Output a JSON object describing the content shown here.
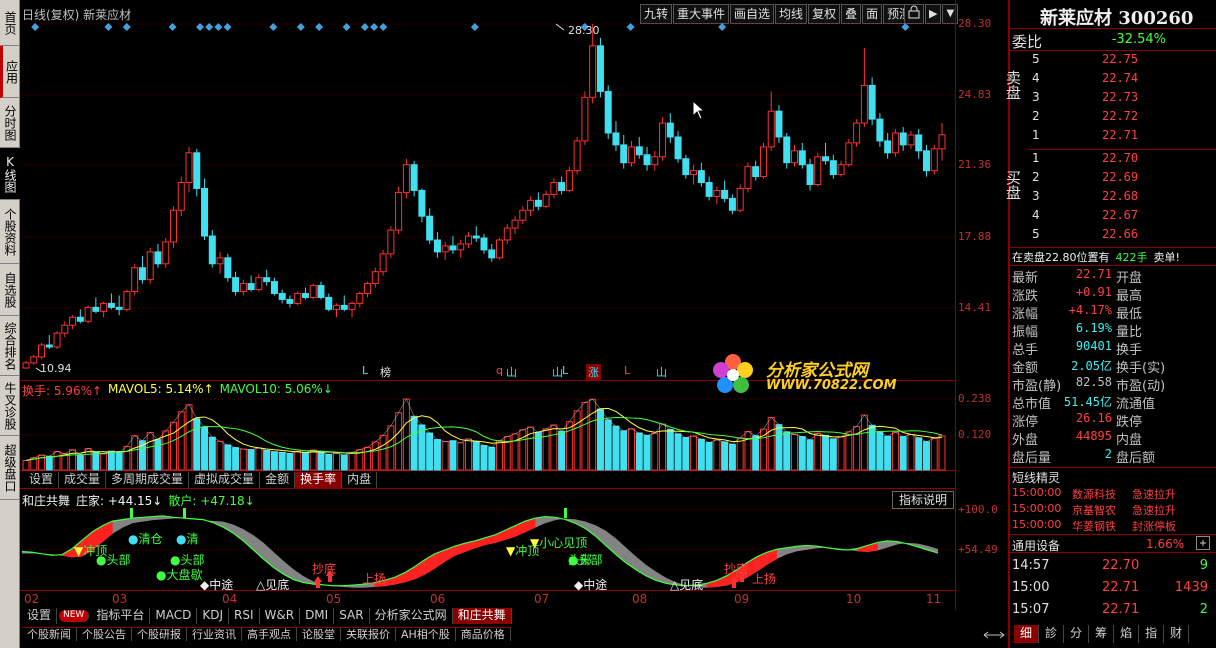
{
  "left_nav": [
    {
      "label": "首页",
      "active": false
    },
    {
      "label": "应用",
      "active": false,
      "accent": true
    },
    {
      "label": "分时图",
      "active": false
    },
    {
      "label": "K线图",
      "active": true,
      "accent": true
    },
    {
      "label": "个股资料",
      "active": false
    },
    {
      "label": "自选股",
      "active": false
    },
    {
      "label": "综合排名",
      "active": false
    },
    {
      "label": "牛叉诊股",
      "active": false
    },
    {
      "label": "超级盘口",
      "active": false
    }
  ],
  "chart_header": {
    "title": "日线(复权)  新莱应材"
  },
  "toolbar": [
    "九转",
    "重大事件",
    "画自选",
    "均线",
    "复权",
    "叠",
    "面",
    "预测"
  ],
  "price_axis": [
    "28.30",
    "24.83",
    "21.36",
    "17.88",
    "14.41"
  ],
  "annotations": {
    "high": "28.30",
    "low": "10.94"
  },
  "event_markers": [
    "L",
    "榜",
    "q",
    "山",
    "山",
    "L",
    "涨",
    "L",
    "山"
  ],
  "volume_header": {
    "label": "换手: 5.96%↑",
    "mavol5": "MAVOL5: 5.14%↑",
    "mavol10": "MAVOL10: 5.06%↓"
  },
  "volume_axis": [
    "0.238",
    "0.120"
  ],
  "volume_tabs": [
    "设置",
    "成交量",
    "多周期成交量",
    "虚拟成交量",
    "金额",
    "换手率",
    "内盘"
  ],
  "volume_tab_active": 5,
  "indicator_header": {
    "name": "和庄共舞",
    "zhuangjia": "庄家: +44.15↓",
    "sanhu": "散户: +47.18↓"
  },
  "indicator_btn": "指标说明",
  "indicator_axis": [
    "+100.0",
    "+54.49"
  ],
  "indicator_labels": [
    {
      "t": "冲顶",
      "c": "#40ff40"
    },
    {
      "t": "头部",
      "c": "#40ff40"
    },
    {
      "t": "清仓",
      "c": "#40ff40"
    },
    {
      "t": "清",
      "c": "#40ff40"
    },
    {
      "t": "头部",
      "c": "#40ff40"
    },
    {
      "t": "头部",
      "c": "#40ff40"
    },
    {
      "t": "大盘歇",
      "c": "#40ff40"
    },
    {
      "t": "中途",
      "c": "#f0f0f0"
    },
    {
      "t": "见底",
      "c": "#f0f0f0"
    },
    {
      "t": "抄底",
      "c": "#ff4040"
    },
    {
      "t": "上扬",
      "c": "#ff4040"
    },
    {
      "t": "冲顶",
      "c": "#40ff40"
    },
    {
      "t": "小心见顶",
      "c": "#40ff40"
    },
    {
      "t": "头部",
      "c": "#40ff40"
    },
    {
      "t": "中途",
      "c": "#f0f0f0"
    },
    {
      "t": "见底",
      "c": "#f0f0f0"
    },
    {
      "t": "抄底",
      "c": "#ff4040"
    },
    {
      "t": "上扬",
      "c": "#ff4040"
    }
  ],
  "x_axis": [
    "02",
    "03",
    "04",
    "05",
    "06",
    "07",
    "08",
    "09",
    "10",
    "11"
  ],
  "indicator_tabs": [
    "设置",
    "NEW",
    "指标平台",
    "MACD",
    "KDJ",
    "RSI",
    "W&R",
    "DMI",
    "SAR",
    "分析家公式网",
    "和庄共舞"
  ],
  "indicator_tab_active": 10,
  "bottom_tabs": [
    "个股新闻",
    "个股公告",
    "个股研报",
    "行业资讯",
    "高手观点",
    "论股堂",
    "关联报价",
    "AH相个股",
    "商品价格"
  ],
  "watermark": {
    "line1": "分析家公式网",
    "line2": "WWW.70822.COM"
  },
  "quote": {
    "stock_name": "新莱应材 300260",
    "weibi_label": "委比",
    "weibi": "-32.54%",
    "sell_label": "卖盘",
    "buy_label": "买盘",
    "sells": [
      {
        "lv": "5",
        "p": "22.75"
      },
      {
        "lv": "4",
        "p": "22.74"
      },
      {
        "lv": "3",
        "p": "22.73"
      },
      {
        "lv": "2",
        "p": "22.72"
      },
      {
        "lv": "1",
        "p": "22.71"
      }
    ],
    "buys": [
      {
        "lv": "1",
        "p": "22.70"
      },
      {
        "lv": "2",
        "p": "22.69"
      },
      {
        "lv": "3",
        "p": "22.68"
      },
      {
        "lv": "4",
        "p": "22.67"
      },
      {
        "lv": "5",
        "p": "22.66"
      }
    ],
    "notice_a": "在卖盘22.80位置有",
    "notice_b": "422手",
    "notice_c": "卖单!",
    "rows": [
      {
        "k": "最新",
        "v": "22.71",
        "c": "#ff4040",
        "k2": "开盘"
      },
      {
        "k": "涨跌",
        "v": "+0.91",
        "c": "#ff4040",
        "k2": "最高"
      },
      {
        "k": "涨幅",
        "v": "+4.17%",
        "c": "#ff4040",
        "k2": "最低"
      },
      {
        "k": "振幅",
        "v": "6.19%",
        "c": "#40f0f0",
        "k2": "量比"
      },
      {
        "k": "总手",
        "v": "90401",
        "c": "#40f0f0",
        "k2": "换手"
      },
      {
        "k": "金额",
        "v": "2.05亿",
        "c": "#40f0f0",
        "k2": "换手(实)"
      },
      {
        "k": "市盈(静)",
        "v": "82.58",
        "c": "#c0c0c0",
        "k2": "市盈(动)"
      },
      {
        "k": "总市值",
        "v": "51.45亿",
        "c": "#40f0f0",
        "k2": "流通值"
      },
      {
        "k": "涨停",
        "v": "26.16",
        "c": "#ff4040",
        "k2": "跌停"
      },
      {
        "k": "外盘",
        "v": "44895",
        "c": "#ff4040",
        "k2": "内盘"
      },
      {
        "k": "盘后量",
        "v": "2",
        "c": "#40f0f0",
        "k2": "盘后额"
      }
    ],
    "short_title": "短线精灵",
    "news": [
      {
        "t": "15:00:00",
        "n": "数源科技",
        "e": "急速拉升"
      },
      {
        "t": "15:00:00",
        "n": "京基智农",
        "e": "急速拉升"
      },
      {
        "t": "15:00:00",
        "n": "华菱钢铁",
        "e": "封涨停板"
      }
    ],
    "sector": "通用设备",
    "sector_pct": "1.66%",
    "ticks": [
      {
        "t": "14:57",
        "p": "22.70",
        "v": "9",
        "c": "#40ff40"
      },
      {
        "t": "15:00",
        "p": "22.71",
        "v": "1439",
        "c": "#ff4040"
      },
      {
        "t": "15:07",
        "p": "22.71",
        "v": "2",
        "c": "#40ff40"
      }
    ],
    "tabs": [
      "细",
      "診",
      "分",
      "筹",
      "焰",
      "指",
      "财"
    ]
  },
  "candles": [
    [
      10.94,
      11.3,
      10.9,
      11.2
    ],
    [
      11.2,
      11.6,
      11.1,
      11.5
    ],
    [
      11.5,
      12.2,
      11.4,
      12.1
    ],
    [
      12.1,
      12.6,
      11.9,
      12.0
    ],
    [
      12.0,
      12.8,
      11.9,
      12.7
    ],
    [
      12.7,
      13.3,
      12.5,
      13.1
    ],
    [
      13.1,
      13.6,
      12.9,
      13.5
    ],
    [
      13.5,
      13.9,
      13.2,
      13.3
    ],
    [
      13.3,
      14.1,
      13.2,
      14.0
    ],
    [
      14.0,
      14.5,
      13.7,
      13.8
    ],
    [
      13.8,
      14.3,
      13.5,
      14.2
    ],
    [
      14.2,
      14.7,
      13.9,
      14.0
    ],
    [
      14.0,
      14.6,
      13.6,
      13.9
    ],
    [
      13.9,
      14.9,
      13.8,
      14.8
    ],
    [
      14.8,
      16.2,
      14.6,
      16.0
    ],
    [
      16.0,
      16.6,
      15.2,
      15.4
    ],
    [
      15.4,
      17.0,
      15.2,
      16.8
    ],
    [
      16.8,
      17.2,
      16.0,
      16.2
    ],
    [
      16.2,
      17.5,
      16.0,
      17.3
    ],
    [
      17.3,
      19.1,
      17.0,
      18.9
    ],
    [
      18.9,
      20.6,
      18.6,
      20.3
    ],
    [
      20.3,
      22.1,
      19.8,
      21.8
    ],
    [
      21.8,
      22.0,
      19.6,
      20.0
    ],
    [
      20.0,
      20.5,
      17.4,
      17.6
    ],
    [
      17.6,
      17.9,
      16.0,
      16.2
    ],
    [
      16.2,
      16.8,
      15.7,
      16.5
    ],
    [
      16.5,
      16.7,
      15.3,
      15.5
    ],
    [
      15.5,
      15.8,
      14.6,
      14.8
    ],
    [
      14.8,
      15.4,
      14.6,
      15.2
    ],
    [
      15.2,
      15.6,
      14.8,
      14.9
    ],
    [
      14.9,
      15.7,
      14.8,
      15.5
    ],
    [
      15.5,
      15.9,
      15.1,
      15.3
    ],
    [
      15.3,
      15.5,
      14.6,
      14.7
    ],
    [
      14.7,
      14.9,
      14.2,
      14.4
    ],
    [
      14.4,
      14.6,
      14.0,
      14.2
    ],
    [
      14.2,
      14.8,
      14.1,
      14.7
    ],
    [
      14.7,
      15.0,
      14.4,
      14.5
    ],
    [
      14.5,
      15.2,
      14.4,
      15.1
    ],
    [
      15.1,
      15.3,
      14.4,
      14.5
    ],
    [
      14.5,
      14.7,
      13.8,
      13.9
    ],
    [
      13.9,
      14.2,
      13.5,
      14.1
    ],
    [
      14.1,
      14.6,
      13.8,
      13.9
    ],
    [
      13.9,
      14.3,
      13.5,
      14.2
    ],
    [
      14.2,
      14.8,
      14.0,
      14.7
    ],
    [
      14.7,
      15.3,
      14.5,
      15.2
    ],
    [
      15.2,
      16.0,
      15.0,
      15.8
    ],
    [
      15.8,
      16.9,
      15.6,
      16.7
    ],
    [
      16.7,
      18.1,
      16.5,
      17.9
    ],
    [
      17.9,
      20.1,
      17.7,
      19.8
    ],
    [
      19.8,
      21.5,
      19.5,
      21.2
    ],
    [
      21.2,
      21.4,
      19.6,
      19.9
    ],
    [
      19.9,
      20.0,
      18.3,
      18.6
    ],
    [
      18.6,
      19.0,
      17.2,
      17.4
    ],
    [
      17.4,
      17.8,
      16.5,
      16.8
    ],
    [
      16.8,
      17.3,
      16.4,
      17.1
    ],
    [
      17.1,
      17.6,
      16.7,
      16.9
    ],
    [
      16.9,
      17.4,
      16.5,
      17.2
    ],
    [
      17.2,
      17.8,
      17.0,
      17.6
    ],
    [
      17.6,
      18.1,
      17.3,
      17.5
    ],
    [
      17.5,
      17.7,
      16.7,
      16.9
    ],
    [
      16.9,
      17.2,
      16.3,
      16.5
    ],
    [
      16.5,
      17.5,
      16.4,
      17.4
    ],
    [
      17.4,
      18.2,
      17.2,
      18.0
    ],
    [
      18.0,
      18.6,
      17.7,
      18.4
    ],
    [
      18.4,
      19.1,
      18.2,
      18.9
    ],
    [
      18.9,
      19.6,
      18.6,
      19.4
    ],
    [
      19.4,
      19.8,
      18.9,
      19.1
    ],
    [
      19.1,
      19.9,
      19.0,
      19.7
    ],
    [
      19.7,
      20.5,
      19.5,
      20.3
    ],
    [
      20.3,
      20.6,
      19.7,
      19.9
    ],
    [
      19.9,
      21.1,
      19.8,
      20.9
    ],
    [
      20.9,
      22.6,
      20.7,
      22.4
    ],
    [
      22.4,
      24.9,
      22.2,
      24.6
    ],
    [
      24.6,
      28.3,
      24.3,
      27.2
    ],
    [
      27.2,
      27.6,
      24.6,
      24.9
    ],
    [
      24.9,
      25.2,
      22.5,
      22.8
    ],
    [
      22.8,
      23.4,
      21.9,
      22.2
    ],
    [
      22.2,
      22.7,
      21.0,
      21.3
    ],
    [
      21.3,
      22.4,
      21.1,
      22.1
    ],
    [
      22.1,
      22.6,
      21.5,
      21.7
    ],
    [
      21.7,
      22.1,
      20.9,
      21.2
    ],
    [
      21.2,
      21.9,
      20.9,
      21.6
    ],
    [
      21.6,
      23.6,
      21.4,
      23.3
    ],
    [
      23.3,
      23.8,
      22.3,
      22.6
    ],
    [
      22.6,
      22.9,
      21.3,
      21.5
    ],
    [
      21.5,
      21.7,
      20.5,
      20.7
    ],
    [
      20.7,
      21.2,
      20.2,
      20.9
    ],
    [
      20.9,
      21.3,
      20.1,
      20.3
    ],
    [
      20.3,
      20.6,
      19.4,
      19.6
    ],
    [
      19.6,
      20.1,
      19.2,
      19.9
    ],
    [
      19.9,
      20.4,
      19.3,
      19.5
    ],
    [
      19.5,
      19.7,
      18.7,
      18.9
    ],
    [
      18.9,
      20.2,
      18.8,
      20.0
    ],
    [
      20.0,
      21.3,
      19.8,
      21.1
    ],
    [
      21.1,
      21.4,
      20.4,
      20.6
    ],
    [
      20.6,
      22.3,
      20.5,
      22.1
    ],
    [
      22.1,
      24.9,
      21.9,
      23.9
    ],
    [
      23.9,
      24.2,
      22.3,
      22.6
    ],
    [
      22.6,
      22.8,
      21.0,
      21.3
    ],
    [
      21.3,
      22.2,
      21.1,
      21.9
    ],
    [
      21.9,
      22.3,
      21.0,
      21.2
    ],
    [
      21.2,
      21.5,
      19.9,
      20.2
    ],
    [
      20.2,
      21.8,
      20.1,
      21.6
    ],
    [
      21.6,
      22.3,
      21.2,
      21.4
    ],
    [
      21.4,
      21.7,
      20.5,
      20.7
    ],
    [
      20.7,
      21.4,
      20.6,
      21.2
    ],
    [
      21.2,
      22.5,
      21.1,
      22.3
    ],
    [
      22.3,
      23.5,
      22.1,
      23.3
    ],
    [
      23.3,
      27.1,
      23.1,
      25.2
    ],
    [
      25.2,
      25.6,
      23.2,
      23.5
    ],
    [
      23.5,
      23.8,
      22.1,
      22.4
    ],
    [
      22.4,
      22.8,
      21.5,
      21.8
    ],
    [
      21.8,
      23.0,
      21.6,
      22.8
    ],
    [
      22.8,
      23.1,
      21.9,
      22.2
    ],
    [
      22.2,
      22.9,
      22.0,
      22.7
    ],
    [
      22.7,
      23.0,
      21.5,
      21.9
    ],
    [
      21.9,
      22.2,
      20.6,
      20.9
    ],
    [
      20.9,
      22.2,
      20.7,
      22.0
    ],
    [
      22.0,
      23.3,
      21.4,
      22.71
    ]
  ],
  "volume": [
    3.2,
    4.1,
    5.0,
    4.6,
    6.2,
    5.5,
    6.8,
    5.1,
    7.2,
    6.0,
    5.4,
    6.3,
    5.8,
    7.9,
    11.5,
    9.8,
    12.6,
    10.2,
    13.1,
    16.0,
    19.5,
    21.9,
    17.2,
    14.3,
    11.0,
    9.6,
    8.4,
    7.5,
    7.0,
    6.8,
    7.4,
    6.6,
    6.1,
    5.9,
    5.5,
    6.3,
    5.8,
    6.7,
    6.1,
    5.2,
    5.6,
    5.0,
    5.9,
    6.8,
    7.6,
    9.4,
    11.6,
    14.8,
    19.2,
    23.8,
    18.0,
    15.1,
    12.4,
    10.2,
    9.5,
    9.8,
    9.1,
    10.4,
    9.6,
    8.2,
    7.6,
    9.9,
    11.2,
    12.1,
    13.5,
    14.4,
    12.6,
    13.8,
    15.1,
    13.0,
    16.2,
    19.8,
    22.6,
    23.7,
    20.4,
    16.8,
    14.7,
    13.1,
    13.8,
    12.4,
    11.6,
    12.3,
    15.4,
    13.6,
    12.1,
    10.9,
    11.4,
    10.3,
    9.2,
    10.1,
    9.4,
    8.6,
    10.8,
    12.9,
    11.5,
    13.7,
    17.6,
    15.2,
    12.8,
    11.9,
    11.2,
    10.1,
    12.3,
    11.6,
    10.4,
    11.1,
    12.8,
    14.6,
    18.4,
    15.0,
    12.6,
    11.3,
    12.7,
    11.2,
    11.9,
    10.8,
    9.5,
    10.6,
    11.4
  ],
  "indicator": [
    0.48,
    0.47,
    0.45,
    0.43,
    0.44,
    0.52,
    0.63,
    0.74,
    0.82,
    0.88,
    0.9,
    0.92,
    0.93,
    0.94,
    0.95,
    0.93,
    0.92,
    0.91,
    0.9,
    0.86,
    0.8,
    0.72,
    0.62,
    0.5,
    0.38,
    0.27,
    0.18,
    0.11,
    0.07,
    0.05,
    0.04,
    0.03,
    0.03,
    0.04,
    0.05,
    0.07,
    0.1,
    0.14,
    0.2,
    0.28,
    0.37,
    0.45,
    0.5,
    0.55,
    0.59,
    0.62,
    0.66,
    0.7,
    0.76,
    0.82,
    0.88,
    0.92,
    0.94,
    0.93,
    0.9,
    0.85,
    0.78,
    0.68,
    0.56,
    0.44,
    0.33,
    0.24,
    0.16,
    0.1,
    0.06,
    0.04,
    0.03,
    0.04,
    0.06,
    0.1,
    0.16,
    0.24,
    0.33,
    0.41,
    0.47,
    0.51,
    0.53,
    0.55,
    0.56,
    0.55,
    0.53,
    0.51,
    0.5,
    0.52,
    0.56,
    0.6,
    0.62,
    0.61,
    0.58,
    0.54,
    0.5,
    0.46
  ]
}
